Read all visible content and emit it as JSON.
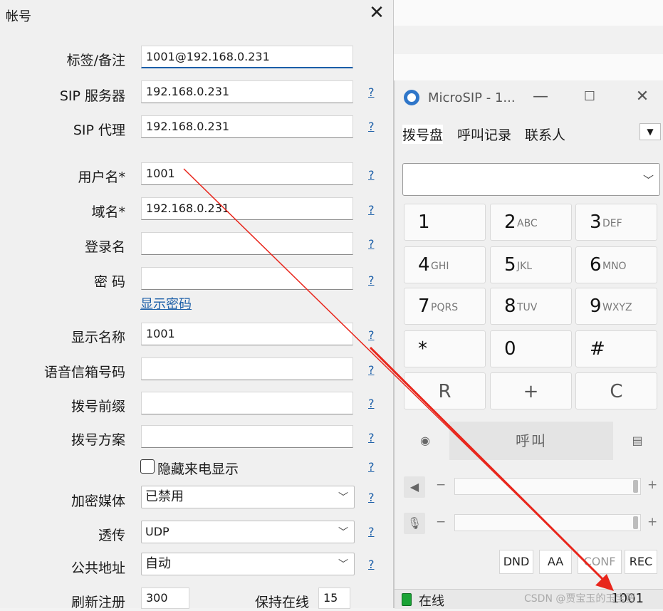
{
  "account": {
    "title": "帐号",
    "labels": {
      "tag": "标签/备注",
      "sip_server": "SIP 服务器",
      "sip_proxy": "SIP 代理",
      "username": "用户名*",
      "domain": "域名*",
      "login": "登录名",
      "password": "密 码",
      "display_name": "显示名称",
      "voicemail": "语音信箱号码",
      "dial_prefix": "拨号前缀",
      "dial_plan": "拨号方案",
      "encryption": "加密媒体",
      "transport": "透传",
      "public_address": "公共地址",
      "refresh": "刷新注册",
      "keepalive": "保持在线"
    },
    "values": {
      "tag": "1001@192.168.0.231",
      "sip_server": "192.168.0.231",
      "sip_proxy": "192.168.0.231",
      "username": "1001",
      "domain": "192.168.0.231",
      "login": "",
      "password": "",
      "display_name": "1001",
      "voicemail": "",
      "dial_prefix": "",
      "dial_plan": "",
      "encryption": "已禁用",
      "transport": "UDP",
      "public_address": "自动",
      "refresh": "300",
      "keepalive": "15"
    },
    "show_password": "显示密码",
    "hide_caller_id": "隐藏来电显示",
    "help": "?"
  },
  "microsip": {
    "title": "MicroSIP - 1...",
    "tabs": [
      "拨号盘",
      "呼叫记录",
      "联系人"
    ],
    "keys": [
      {
        "d": "1",
        "l": ""
      },
      {
        "d": "2",
        "l": "ABC"
      },
      {
        "d": "3",
        "l": "DEF"
      },
      {
        "d": "4",
        "l": "GHI"
      },
      {
        "d": "5",
        "l": "JKL"
      },
      {
        "d": "6",
        "l": "MNO"
      },
      {
        "d": "7",
        "l": "PQRS"
      },
      {
        "d": "8",
        "l": "TUV"
      },
      {
        "d": "9",
        "l": "WXYZ"
      },
      {
        "d": "*",
        "l": ""
      },
      {
        "d": "0",
        "l": ""
      },
      {
        "d": "#",
        "l": ""
      }
    ],
    "controls": [
      "R",
      "+",
      "C"
    ],
    "call": "呼叫",
    "buttons": [
      "DND",
      "AA",
      "CONF",
      "REC"
    ],
    "status": "在线",
    "account_number": "1001",
    "minus": "−",
    "plus": "+"
  },
  "watermark": "CSDN @贾宝玉的玉宝贾"
}
